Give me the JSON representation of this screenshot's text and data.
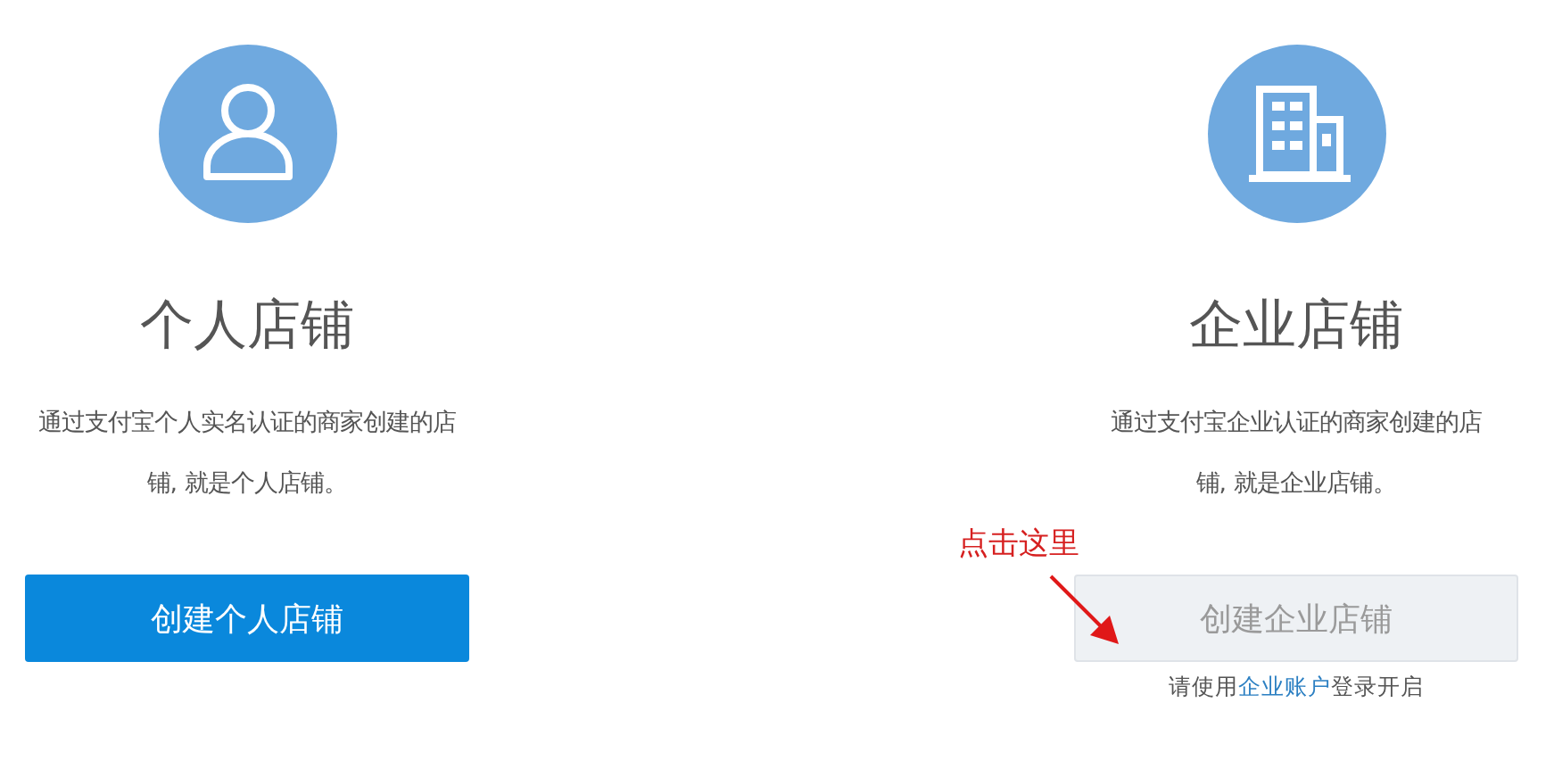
{
  "cards": [
    {
      "kind": "person",
      "title": "个人店铺",
      "description": "通过支付宝个人实名认证的商家创建的店铺, 就是个人店铺。",
      "button": {
        "label": "创建个人店铺",
        "disabled": false
      }
    },
    {
      "kind": "company",
      "title": "企业店铺",
      "description": "通过支付宝企业认证的商家创建的店铺, 就是企业店铺。",
      "button": {
        "label": "创建企业店铺",
        "disabled": true
      },
      "note": {
        "before": "请使用",
        "link": "企业账户",
        "after": "登录开启"
      }
    }
  ],
  "annotation": {
    "text": "点击这里"
  }
}
